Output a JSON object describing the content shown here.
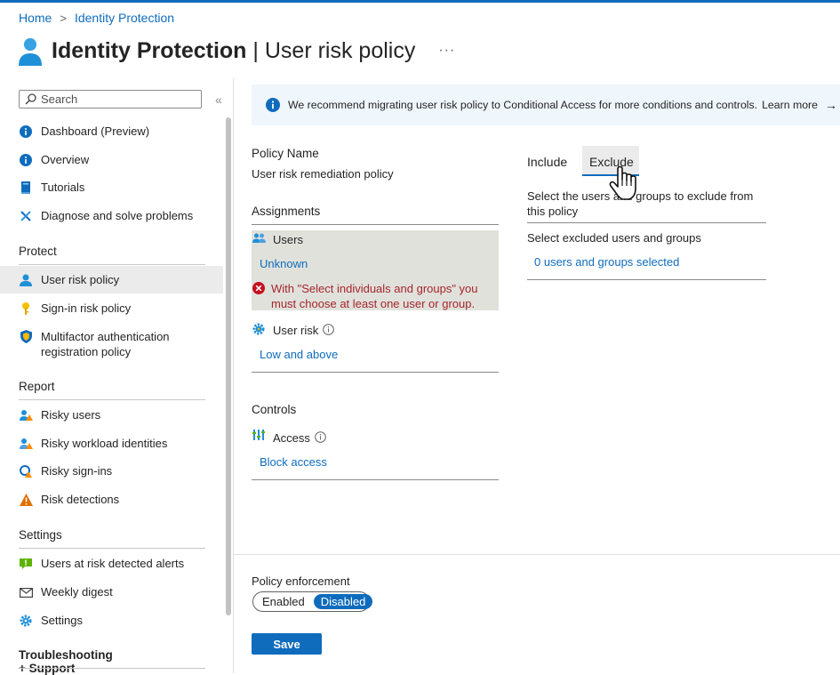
{
  "breadcrumb": {
    "home": "Home",
    "current": "Identity Protection"
  },
  "header": {
    "title_bold": "Identity Protection",
    "title_rest": " | User risk policy",
    "more": "···"
  },
  "sidebar": {
    "search_placeholder": "Search",
    "collapse": "«",
    "items_top": [
      {
        "label": "Dashboard (Preview)",
        "icon": "info-icon"
      },
      {
        "label": "Overview",
        "icon": "info-icon"
      },
      {
        "label": "Tutorials",
        "icon": "book-icon"
      },
      {
        "label": "Diagnose and solve problems",
        "icon": "wrench-icon"
      }
    ],
    "sections": {
      "protect": "Protect",
      "report": "Report",
      "settings": "Settings",
      "support": "Troubleshooting + Support"
    },
    "protect_items": [
      {
        "label": "User risk policy",
        "icon": "user-icon"
      },
      {
        "label": "Sign-in risk policy",
        "icon": "key-icon"
      },
      {
        "label": "Multifactor authentication registration policy",
        "icon": "shield-icon"
      }
    ],
    "report_items": [
      {
        "label": "Risky users",
        "icon": "risky-users-icon"
      },
      {
        "label": "Risky workload identities",
        "icon": "risky-workload-icon"
      },
      {
        "label": "Risky sign-ins",
        "icon": "risky-signin-icon"
      },
      {
        "label": "Risk detections",
        "icon": "warning-icon"
      }
    ],
    "settings_items": [
      {
        "label": "Users at risk detected alerts",
        "icon": "alert-icon"
      },
      {
        "label": "Weekly digest",
        "icon": "mail-icon"
      },
      {
        "label": "Settings",
        "icon": "gear-icon"
      }
    ]
  },
  "banner": {
    "text": "We recommend migrating user risk policy to Conditional Access for more conditions and controls.",
    "link": "Learn more",
    "arrow": "→"
  },
  "policy": {
    "name_label": "Policy Name",
    "name_value": "User risk remediation policy",
    "assignments_label": "Assignments",
    "users_label": "Users",
    "users_value": "Unknown",
    "users_error": "With \"Select individuals and groups\" you must choose at least one user or group.",
    "user_risk_label": "User risk",
    "user_risk_value": "Low and above",
    "controls_label": "Controls",
    "access_label": "Access",
    "access_value": "Block access"
  },
  "right_panel": {
    "tab_include": "Include",
    "tab_exclude": "Exclude",
    "description": "Select the users and groups to exclude from this policy",
    "select_label": "Select excluded users and groups",
    "selected_link": "0 users and groups selected"
  },
  "enforcement": {
    "label": "Policy enforcement",
    "enabled": "Enabled",
    "disabled": "Disabled",
    "selected": "Disabled"
  },
  "save_label": "Save",
  "colors": {
    "accent": "#0f6cbd",
    "error": "#a4262c",
    "banner_bg": "#eff6fc"
  }
}
